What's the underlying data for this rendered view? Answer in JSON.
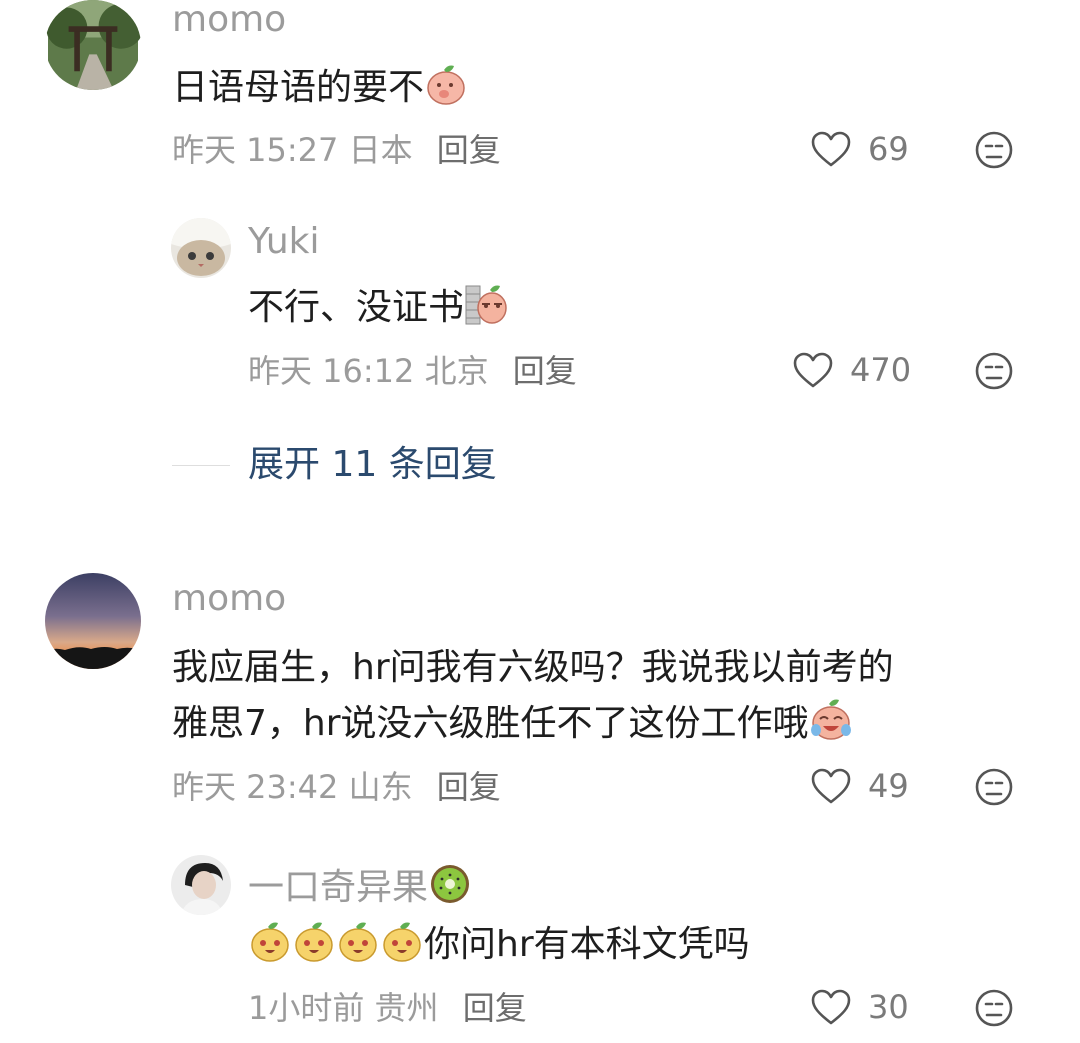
{
  "comments": [
    {
      "name": "momo",
      "text": "日语母语的要不",
      "time": "昨天 15:27",
      "location": "日本",
      "reply_label": "回复",
      "likes": "69"
    },
    {
      "name": "Yuki",
      "text": "不行、没证书",
      "time": "昨天 16:12",
      "location": "北京",
      "reply_label": "回复",
      "likes": "470"
    },
    {
      "name": "momo",
      "text_line1": "我应届生，hr问我有六级吗？我说我以前考的",
      "text_line2": "雅思7，hr说没六级胜任不了这份工作哦",
      "time": "昨天 23:42",
      "location": "山东",
      "reply_label": "回复",
      "likes": "49"
    },
    {
      "name": "一口奇异果",
      "text": "你问hr有本科文凭吗",
      "time": "1小时前",
      "location": "贵州",
      "reply_label": "回复",
      "likes": "30"
    }
  ],
  "expand_replies": "展开 11 条回复",
  "colors": {
    "name": "#9b9b9b",
    "text": "#1e1e1e",
    "meta": "#9b9b9b",
    "link": "#2b4a6e"
  }
}
